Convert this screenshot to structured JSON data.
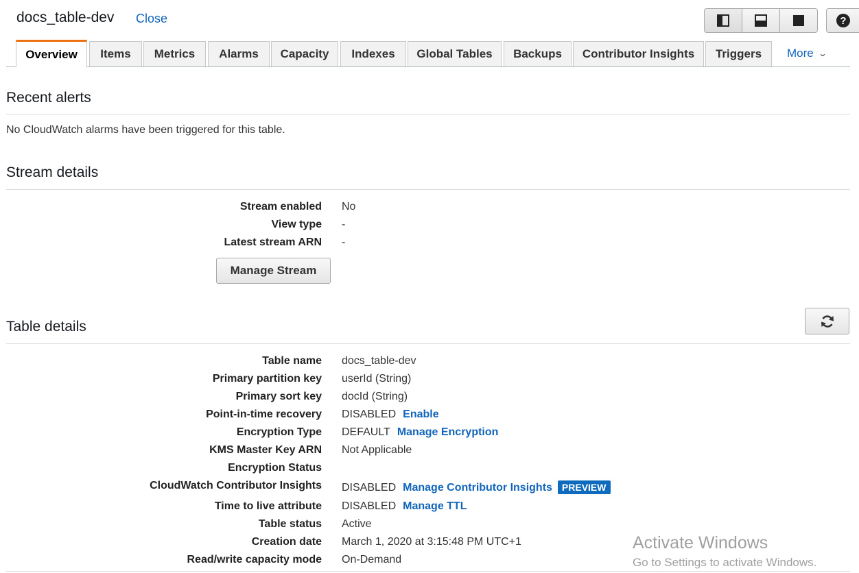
{
  "header": {
    "title": "docs_table-dev",
    "close_label": "Close",
    "view_buttons": [
      "split-vertical-icon",
      "split-horizontal-icon",
      "full-screen-icon"
    ],
    "help_label": "?"
  },
  "tabs": {
    "items": [
      "Overview",
      "Items",
      "Metrics",
      "Alarms",
      "Capacity",
      "Indexes",
      "Global Tables",
      "Backups",
      "Contributor Insights",
      "Triggers"
    ],
    "active": "Overview",
    "more_label": "More"
  },
  "recent_alerts": {
    "title": "Recent alerts",
    "message": "No CloudWatch alarms have been triggered for this table."
  },
  "stream_details": {
    "title": "Stream details",
    "rows": [
      {
        "label": "Stream enabled",
        "value": "No"
      },
      {
        "label": "View type",
        "value": "-"
      },
      {
        "label": "Latest stream ARN",
        "value": "-"
      }
    ],
    "manage_button": "Manage Stream"
  },
  "table_details": {
    "title": "Table details",
    "refresh_icon": "refresh-icon",
    "rows": [
      {
        "label": "Table name",
        "value": "docs_table-dev"
      },
      {
        "label": "Primary partition key",
        "value": "userId (String)"
      },
      {
        "label": "Primary sort key",
        "value": "docId (String)"
      },
      {
        "label": "Point-in-time recovery",
        "value": "DISABLED",
        "link": "Enable"
      },
      {
        "label": "Encryption Type",
        "value": "DEFAULT",
        "link": "Manage Encryption"
      },
      {
        "label": "KMS Master Key ARN",
        "value": "Not Applicable"
      },
      {
        "label": "Encryption Status",
        "value": ""
      },
      {
        "label": "CloudWatch Contributor Insights",
        "value": "DISABLED",
        "link": "Manage Contributor Insights",
        "badge": "PREVIEW"
      },
      {
        "label": "Time to live attribute",
        "value": "DISABLED",
        "link": "Manage TTL"
      },
      {
        "label": "Table status",
        "value": "Active"
      },
      {
        "label": "Creation date",
        "value": "March 1, 2020 at 3:15:48 PM UTC+1"
      },
      {
        "label": "Read/write capacity mode",
        "value": "On-Demand"
      }
    ]
  },
  "watermark": {
    "line1": "Activate Windows",
    "line2": "Go to Settings to activate Windows."
  },
  "colors": {
    "link": "#1166bb",
    "active_tab_accent": "#ec7211",
    "badge": "#0f6bbd"
  }
}
